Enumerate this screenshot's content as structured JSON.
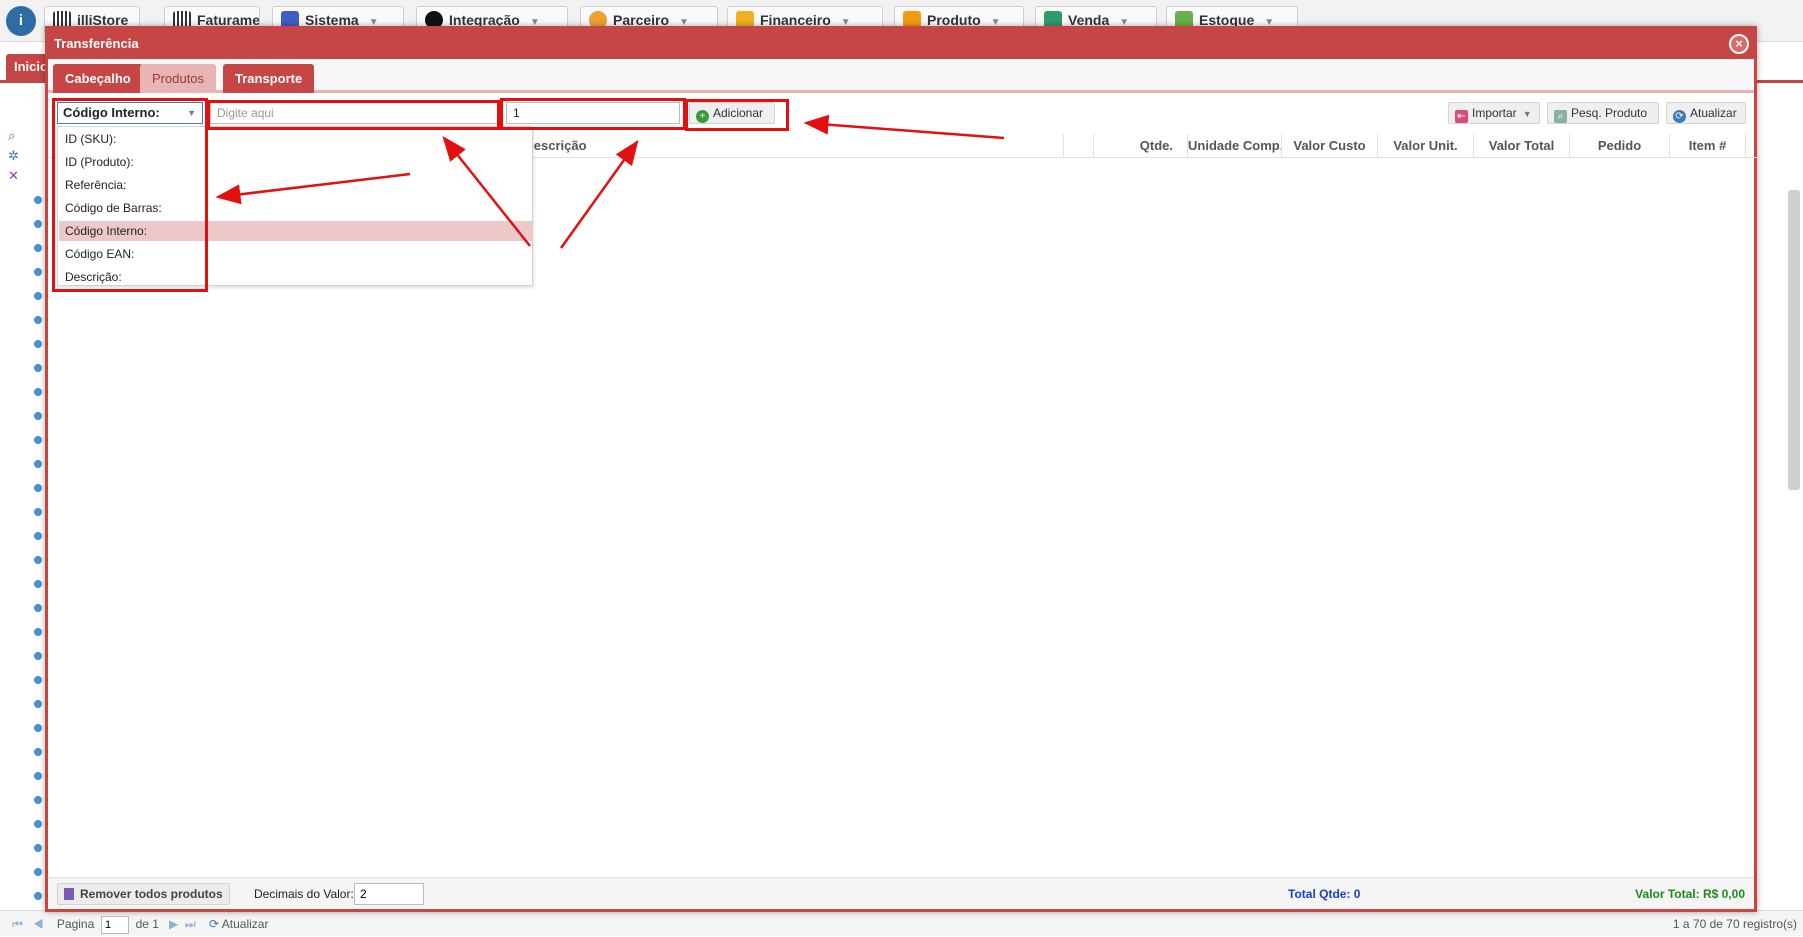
{
  "app": {
    "top_menus": [
      {
        "label": "illiStore",
        "icon": "barcode-icon"
      },
      {
        "label": "Faturamento",
        "icon": "barcode-icon"
      },
      {
        "label": "Sistema",
        "icon": "gear-icon"
      },
      {
        "label": "Integração",
        "icon": "integration-icon"
      },
      {
        "label": "Parceiro",
        "icon": "people-icon"
      },
      {
        "label": "Financeiro",
        "icon": "chart-icon"
      },
      {
        "label": "Produto",
        "icon": "box-icon"
      },
      {
        "label": "Venda",
        "icon": "cart-icon"
      },
      {
        "label": "Estoque",
        "icon": "cube-icon"
      }
    ],
    "start_tab": "Inicio",
    "footer": {
      "page_label": "Pagina",
      "page_value": "1",
      "of_label": "de 1",
      "refresh_label": "Atualizar",
      "records": "1 a 70 de 70 registro(s)"
    }
  },
  "modal": {
    "title": "Transferência",
    "tabs": [
      {
        "label": "Cabeçalho"
      },
      {
        "label": "Produtos"
      },
      {
        "label": "Transporte"
      }
    ],
    "toolbar": {
      "search_type": "Código Interno:",
      "search_placeholder": "Digite aqui",
      "quantity_value": "1",
      "add_label": "Adicionar",
      "import_label": "Importar",
      "search_product_label": "Pesq. Produto",
      "refresh_label": "Atualizar"
    },
    "columns": [
      "Descrição",
      "Qtde.",
      "Unidade Comp.",
      "Valor Custo",
      "Valor Unit.",
      "Valor Total",
      "Pedido",
      "Item #"
    ],
    "dropdown_options": [
      {
        "label": "ID (SKU):"
      },
      {
        "label": "ID (Produto):"
      },
      {
        "label": "Referência:"
      },
      {
        "label": "Código de Barras:"
      },
      {
        "label": "Código Interno:"
      },
      {
        "label": "Código EAN:"
      },
      {
        "label": "Descrição:"
      }
    ],
    "selected_option": "Código Interno:",
    "footer": {
      "remove_all_label": "Remover todos produtos",
      "decimals_label": "Decimais do Valor:",
      "decimals_value": "2",
      "total_qty": "Total Qtde: 0",
      "total_value": "Valor Total: R$ 0,00"
    }
  },
  "colors": {
    "accent": "#c64545",
    "annotation": "#e31010",
    "total_qty": "#1a3fc9",
    "total_value": "#1d8a1d"
  }
}
